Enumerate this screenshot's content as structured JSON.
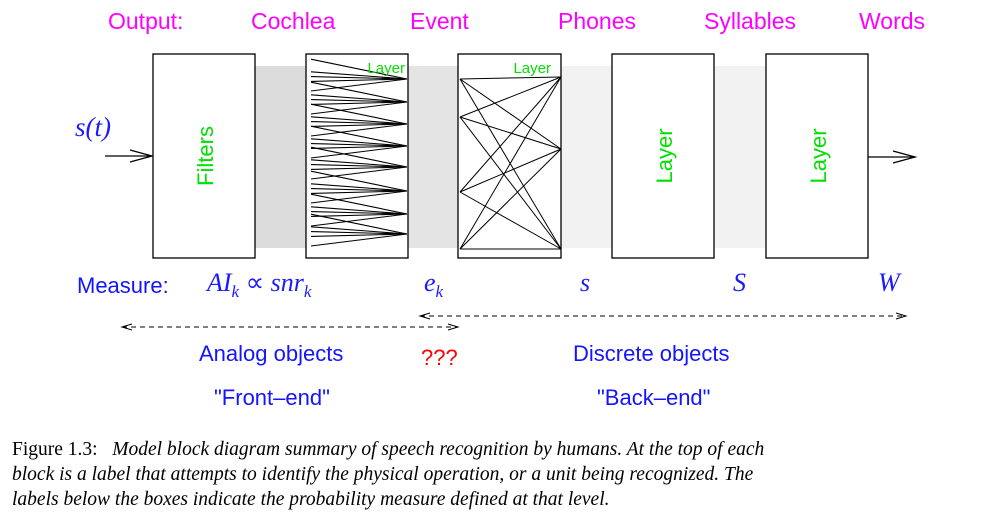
{
  "top_labels": {
    "output": "Output:",
    "cochlea": "Cochlea",
    "event": "Event",
    "phones": "Phones",
    "syllables": "Syllables",
    "words": "Words"
  },
  "input_signal": "s(t)",
  "blocks": [
    {
      "id": "filters",
      "label": "Filters",
      "label_orientation": "vertical"
    },
    {
      "id": "cochlea-layer",
      "label": "Layer",
      "label_orientation": "horizontal-top"
    },
    {
      "id": "event-layer",
      "label": "Layer",
      "label_orientation": "horizontal-top"
    },
    {
      "id": "phones-layer",
      "label": "Layer",
      "label_orientation": "vertical"
    },
    {
      "id": "syllables-layer",
      "label": "Layer",
      "label_orientation": "vertical"
    }
  ],
  "measures": {
    "prefix": "Measure:",
    "ai_base": "AI",
    "ai_sub": "k",
    "proportional": "∝",
    "snr_base": "snr",
    "snr_sub": "k",
    "e_base": "e",
    "e_sub": "k",
    "s_small": "s",
    "s_big": "S",
    "w": "W"
  },
  "regions": {
    "analog_label": "Analog objects",
    "unknown_label": "???",
    "discrete_label": "Discrete objects",
    "front_end_label": "\"Front–end\"",
    "back_end_label": "\"Back–end\""
  },
  "colors": {
    "top_label": "#ff00ff",
    "layer_label": "#00e000",
    "math": "#1a1aff",
    "unknown": "#ff0000",
    "band_dark": "#dcdcdc",
    "band_mid": "#e4e4e4",
    "band_light": "#f2f2f2"
  },
  "caption": {
    "lead": "Figure 1.3:",
    "line1": "Model block diagram summary of speech recognition by humans. At the top of each",
    "line2": "block is a label that attempts to identify the physical operation, or a unit being recognized. The",
    "line3": "labels below the boxes indicate the probability measure defined at that level."
  }
}
